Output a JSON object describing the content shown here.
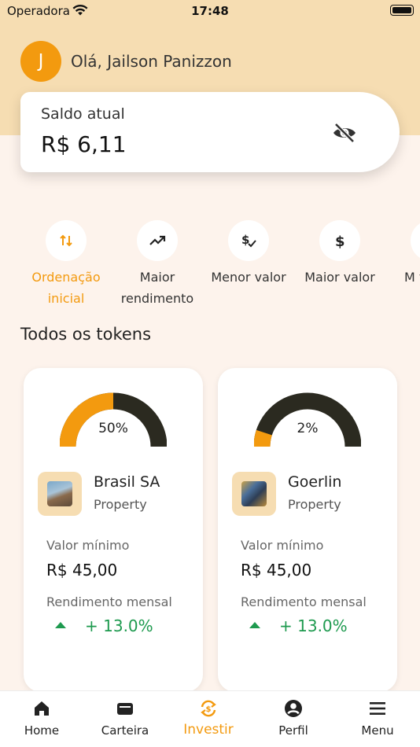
{
  "status_bar": {
    "carrier": "Operadora",
    "time": "17:48"
  },
  "header": {
    "avatar_initial": "J",
    "greeting": "Olá, Jailson Panizzon"
  },
  "balance": {
    "label": "Saldo atual",
    "value": "R$ 6,11",
    "visibility_icon": "eye-off-icon"
  },
  "filters": [
    {
      "label": "Ordenação inicial",
      "icon": "sort-arrows-icon",
      "active": true
    },
    {
      "label": "Maior rendimento",
      "icon": "trending-up-icon",
      "active": false
    },
    {
      "label": "Menor valor",
      "icon": "dollar-check-icon",
      "active": false
    },
    {
      "label": "Maior valor",
      "icon": "dollar-icon",
      "active": false
    },
    {
      "label": "M ven",
      "icon": "circle-icon",
      "active": false
    }
  ],
  "section_title": "Todos os tokens",
  "tokens": [
    {
      "gauge_percent": "50%",
      "gauge_fraction": 0.5,
      "name": "Brasil SA",
      "type": "Property",
      "min_label": "Valor mínimo",
      "min_value": "R$ 45,00",
      "yield_label": "Rendimento mensal",
      "yield_value": "+ 13.0%"
    },
    {
      "gauge_percent": "2%",
      "gauge_fraction": 0.1,
      "name": "Goerlin",
      "type": "Property",
      "min_label": "Valor mínimo",
      "min_value": "R$ 45,00",
      "yield_label": "Rendimento mensal",
      "yield_value": "+ 13.0%"
    }
  ],
  "tabs": [
    {
      "label": "Home",
      "icon": "home-icon",
      "active": false
    },
    {
      "label": "Carteira",
      "icon": "wallet-icon",
      "active": false
    },
    {
      "label": "Investir",
      "icon": "invest-exchange-icon",
      "active": true
    },
    {
      "label": "Perfil",
      "icon": "profile-icon",
      "active": false
    },
    {
      "label": "Menu",
      "icon": "menu-icon",
      "active": false
    }
  ],
  "colors": {
    "accent": "#f39a0f",
    "header_bg": "#f6ddb2",
    "page_bg": "#fdf3ec",
    "gauge_track": "#2b2a20",
    "positive": "#1e9a4f"
  }
}
